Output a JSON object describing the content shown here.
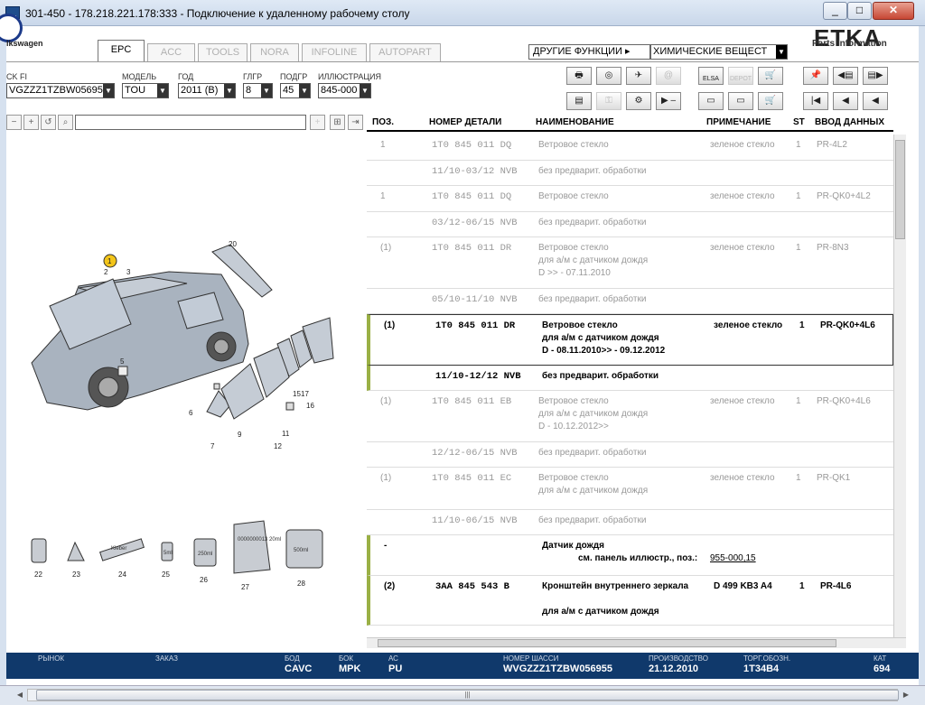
{
  "window": {
    "title": "301-450 - 178.218.221.178:333 - Подключение к удаленному рабочему столу",
    "min": "_",
    "max": "□",
    "close": "✕"
  },
  "brand": {
    "logo_text": "lkswagen",
    "app_name": "ETKA",
    "app_sub": "Parts Information"
  },
  "tabs": [
    {
      "label": "EPC",
      "active": true
    },
    {
      "label": "ACC"
    },
    {
      "label": "TOOLS"
    },
    {
      "label": "NORA"
    },
    {
      "label": "INFOLINE"
    },
    {
      "label": "AUTOPART"
    }
  ],
  "other_functions": "ДРУГИЕ ФУНКЦИИ ▸",
  "chem_dropdown": "ХИМИЧЕСКИЕ ВЕЩЕСТ",
  "filters": {
    "vin_label": "CK FI",
    "vin_value": "VGZZZ1TZBW05695",
    "model_label": "МОДЕЛЬ",
    "model_value": "TOU",
    "year_label": "ГОД",
    "year_value": "2011 (B)",
    "hgrp_label": "ГЛГР",
    "hgrp_value": "8",
    "sgrp_label": "ПОДГР",
    "sgrp_value": "45",
    "illus_label": "ИЛЛЮСТРАЦИЯ",
    "illus_value": "845-000"
  },
  "toolbar_labels": {
    "elsa": "ELSA",
    "depot": "DEPOT"
  },
  "table": {
    "headers": {
      "pos": "ПОЗ.",
      "part": "НОМЕР ДЕТАЛИ",
      "name": "НАИМЕНОВАНИЕ",
      "note": "ПРИМЕЧАНИЕ",
      "st": "ST",
      "input": "ВВОД ДАННЫХ"
    },
    "rows": [
      {
        "pos": "1",
        "part": "1T0 845 011 DQ",
        "name": "Ветровое стекло",
        "note": "зеленое стекло",
        "st": "1",
        "input": "PR-4L2"
      },
      {
        "pos": "",
        "part": "11/10-03/12 NVB",
        "name": "без предварит. обработки",
        "note": "",
        "st": "",
        "input": ""
      },
      {
        "pos": "1",
        "part": "1T0 845 011 DQ",
        "name": "Ветровое стекло",
        "note": "зеленое стекло",
        "st": "1",
        "input": "PR-QK0+4L2"
      },
      {
        "pos": "",
        "part": "03/12-06/15 NVB",
        "name": "без предварит. обработки",
        "note": "",
        "st": "",
        "input": ""
      },
      {
        "pos": "(1)",
        "part": "1T0 845 011 DR",
        "name": "Ветровое стекло\nдля а/м с датчиком дождя\nD >> - 07.11.2010",
        "note": "зеленое стекло",
        "st": "1",
        "input": "PR-8N3"
      },
      {
        "pos": "",
        "part": "05/10-11/10 NVB",
        "name": "без предварит. обработки",
        "note": "",
        "st": "",
        "input": ""
      },
      {
        "pos": "(1)",
        "part": "1T0 845 011 DR",
        "name": "Ветровое стекло\nдля а/м с датчиком дождя\nD - 08.11.2010>> - 09.12.2012",
        "note": "зеленое стекло",
        "st": "1",
        "input": "PR-QK0+4L6"
      },
      {
        "pos": "",
        "part": "11/10-12/12 NVB",
        "name": "без предварит. обработки",
        "note": "",
        "st": "",
        "input": ""
      },
      {
        "pos": "(1)",
        "part": "1T0 845 011 EB",
        "name": "Ветровое стекло\nдля а/м с датчиком дождя\nD - 10.12.2012>>",
        "note": "зеленое стекло",
        "st": "1",
        "input": "PR-QK0+4L6"
      },
      {
        "pos": "",
        "part": "12/12-06/15 NVB",
        "name": "без предварит. обработки",
        "note": "",
        "st": "",
        "input": ""
      },
      {
        "pos": "(1)",
        "part": "1T0 845 011 EC",
        "name": "Ветровое стекло\nдля а/м с датчиком дождя",
        "note": "зеленое стекло",
        "st": "1",
        "input": "PR-QK1"
      },
      {
        "pos": "",
        "part": "11/10-06/15 NVB",
        "name": "без предварит. обработки",
        "note": "",
        "st": "",
        "input": ""
      },
      {
        "pos": "-",
        "part": "",
        "name": "Датчик дождя",
        "name2": "см. панель иллюстр., поз.:",
        "link": "955-000,15",
        "note": "",
        "st": "",
        "input": ""
      },
      {
        "pos": "(2)",
        "part": "3AA 845 543 B",
        "name": "Кронштейн внутреннего зеркала\n\nдля а/м с датчиком дождя",
        "note": "D 499 KB3 A4",
        "st": "1",
        "input": "PR-4L6"
      }
    ]
  },
  "illustration": {
    "labels": [
      "1",
      "2",
      "3",
      "5",
      "6",
      "7",
      "9",
      "11",
      "12",
      "15",
      "16",
      "17",
      "20"
    ],
    "consumables": [
      {
        "num": "22"
      },
      {
        "num": "23"
      },
      {
        "num": "24",
        "text": "Kleber"
      },
      {
        "num": "25",
        "text": "5ml"
      },
      {
        "num": "26",
        "text": "250ml"
      },
      {
        "num": "27",
        "text": "0000000013 20ml"
      },
      {
        "num": "28",
        "text": "500ml"
      }
    ]
  },
  "status": {
    "market_label": "РЫНОК",
    "order_label": "ЗАКАЗ",
    "bod_label": "БОД",
    "bod": "CAVC",
    "bok_label": "БОК",
    "bok": "MPK",
    "ac_label": "АС",
    "ac": "PU",
    "chassis_label": "НОМЕР ШАССИ",
    "chassis": "WVGZZZ1TZBW056955",
    "prod_label": "ПРОИЗВОДСТВО",
    "prod": "21.12.2010",
    "trade_label": "ТОРГ.ОБОЗН.",
    "trade": "1T34B4",
    "cat_label": "КАТ",
    "cat": "694"
  }
}
